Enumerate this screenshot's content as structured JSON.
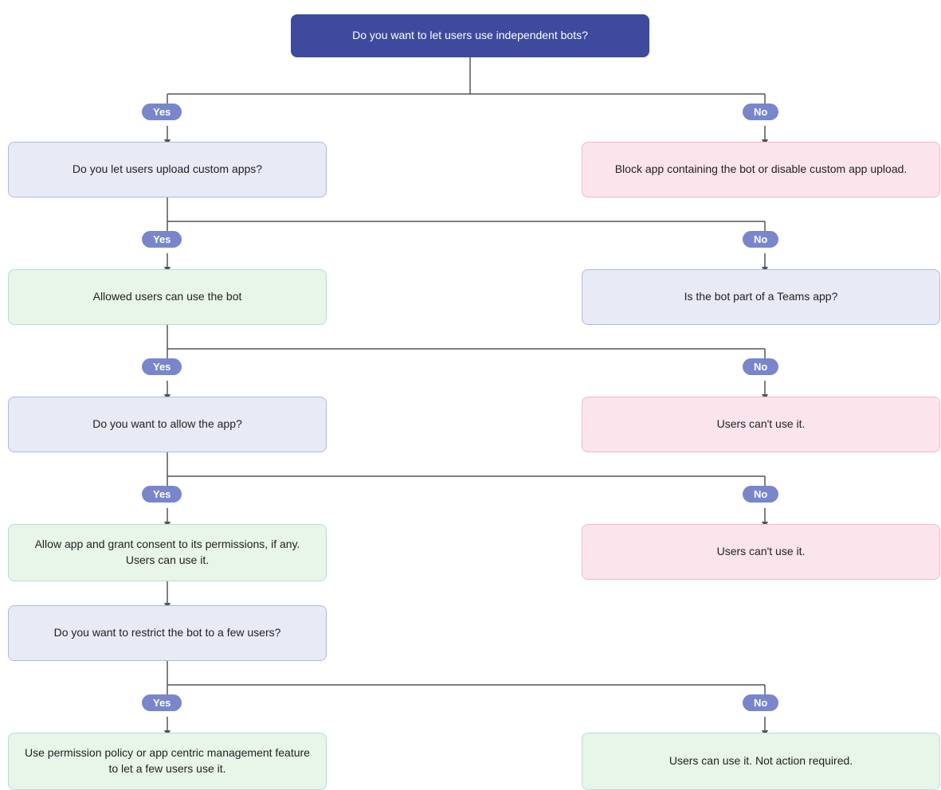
{
  "nodes": {
    "root": {
      "label": "Do you want to let users use independent bots?",
      "type": "blue-dark"
    },
    "n1": {
      "label": "Do you let users upload custom apps?",
      "type": "blue-light"
    },
    "n2": {
      "label": "Block app containing the bot or disable custom app upload.",
      "type": "red"
    },
    "n3": {
      "label": "Allowed users can use the bot",
      "type": "green"
    },
    "n4": {
      "label": "Is the bot part of a Teams app?",
      "type": "blue-light"
    },
    "n5": {
      "label": "Do you want to allow the app?",
      "type": "blue-light"
    },
    "n6": {
      "label": "Users can't use it.",
      "type": "red"
    },
    "n7": {
      "label": "Allow app and grant consent to its permissions, if any. Users can use it.",
      "type": "green"
    },
    "n8": {
      "label": "Users can't use it.",
      "type": "red"
    },
    "n9": {
      "label": "Do you want to restrict the bot to a few users?",
      "type": "blue-light"
    },
    "n10": {
      "label": "Use permission policy or app centric management feature to let a few users use it.",
      "type": "green"
    },
    "n11": {
      "label": "Users can use it. Not action required.",
      "type": "green"
    }
  },
  "badges": {
    "yes1": "Yes",
    "no1": "No",
    "yes2": "Yes",
    "no2": "No",
    "yes3": "Yes",
    "no3": "No",
    "yes4": "Yes",
    "no4": "No",
    "yes5": "Yes",
    "no5": "No"
  }
}
